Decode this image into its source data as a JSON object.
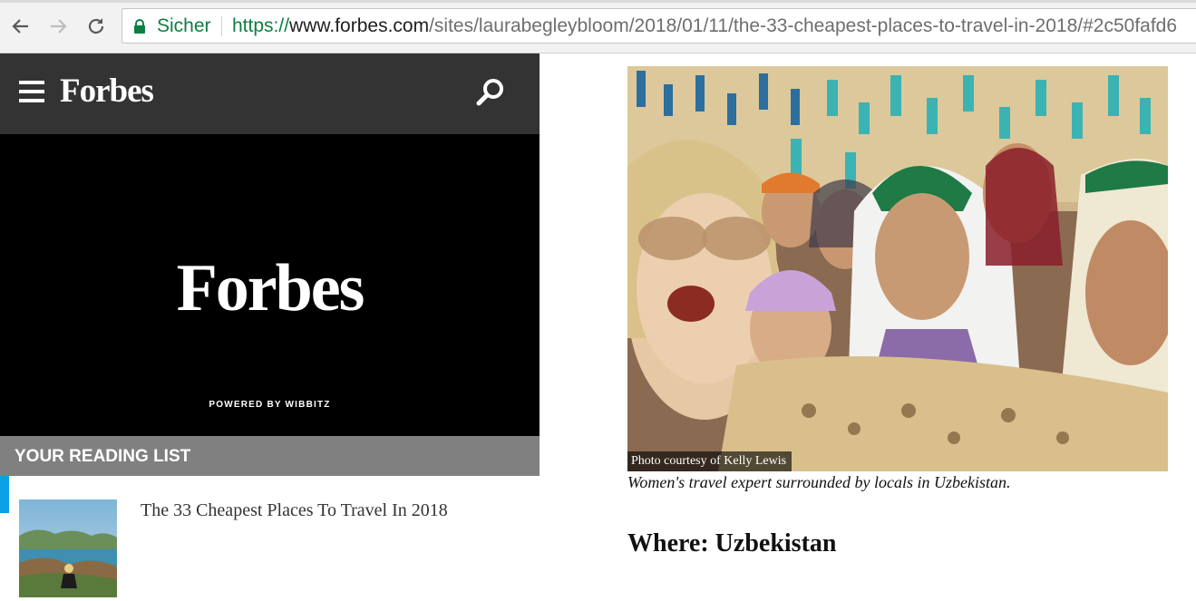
{
  "browser": {
    "back_icon": "arrow-left-icon",
    "forward_icon": "arrow-right-icon",
    "reload_icon": "reload-icon",
    "secure_label": "Sicher",
    "url_protocol": "https://",
    "url_host": "www.forbes.com",
    "url_path": "/sites/laurabegleybloom/2018/01/11/the-33-cheapest-places-to-travel-in-2018/#2c50fafd6"
  },
  "header": {
    "menu_icon": "hamburger-icon",
    "logo": "Forbes",
    "search_icon": "search-icon"
  },
  "video": {
    "logo": "Forbes",
    "powered_by": "POWERED BY WIBBITZ"
  },
  "reading_list": {
    "title": "YOUR READING LIST",
    "items": [
      {
        "title": "The 33 Cheapest Places To Travel In 2018"
      }
    ]
  },
  "article": {
    "photo_credit": "Photo courtesy of Kelly Lewis",
    "caption": "Women's travel expert surrounded by locals in Uzbekistan.",
    "heading": "Where: Uzbekistan"
  },
  "colors": {
    "header_bg": "#333333",
    "reading_bar_bg": "#808080",
    "accent": "#0aa0e3",
    "secure_green": "#0b8043"
  }
}
